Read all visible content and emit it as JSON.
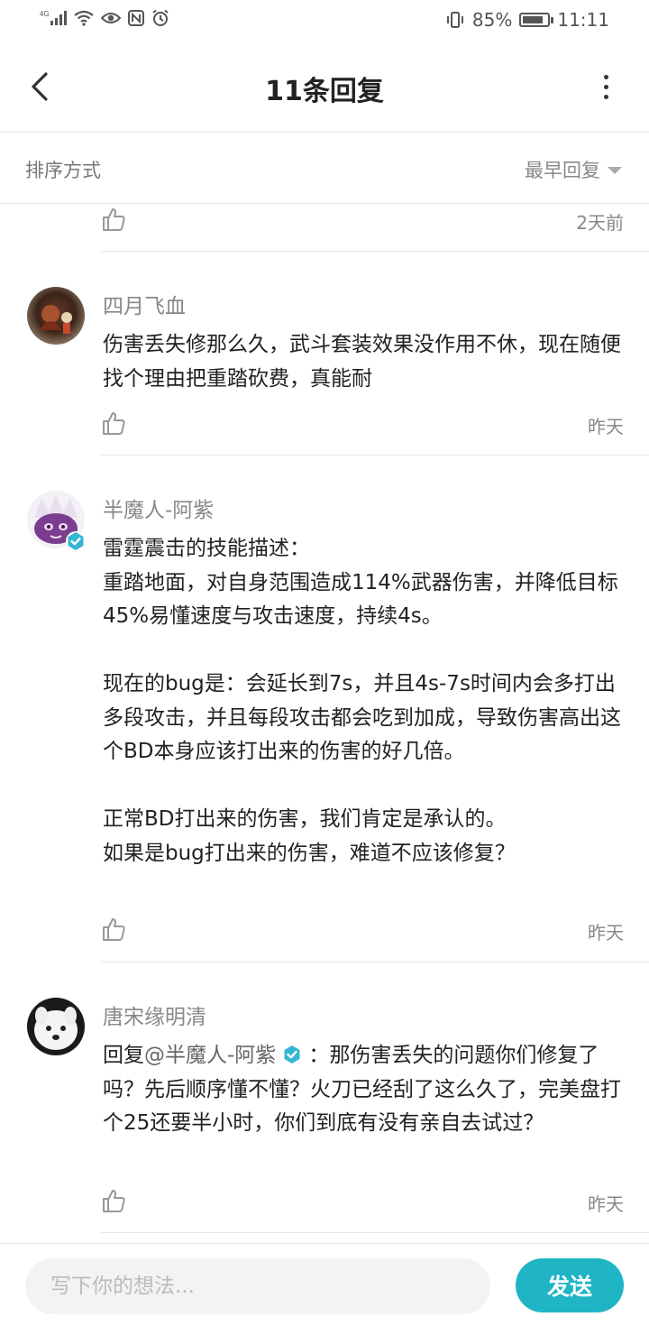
{
  "status_bar": {
    "network": "4G",
    "battery_pct": "85%",
    "battery_level": 0.85,
    "time": "11:11"
  },
  "header": {
    "title": "11条回复"
  },
  "sort": {
    "label": "排序方式",
    "value": "最早回复"
  },
  "comments": [
    {
      "time": "2天前"
    },
    {
      "username": "四月飞血",
      "content": "伤害丢失修那么久，武斗套装效果没作用不休，现在随便找个理由把重踏砍费，真能耐",
      "time": "昨天"
    },
    {
      "username": "半魔人-阿紫",
      "content": "雷霆震击的技能描述：\n重踏地面，对自身范围造成114%武器伤害，并降低目标45%易懂速度与攻击速度，持续4s。\n\n现在的bug是：会延长到7s，并且4s-7s时间内会多打出多段攻击，并且每段攻击都会吃到加成，导致伤害高出这个BD本身应该打出来的伤害的好几倍。\n\n正常BD打出来的伤害，我们肯定是承认的。\n如果是bug打出来的伤害，难道不应该修复？",
      "time": "昨天"
    },
    {
      "username": "唐宋缘明清",
      "reply_prefix": "回复",
      "reply_to": "@半魔人-阿紫",
      "content": "：那伤害丢失的问题你们修复了吗？先后顺序懂不懂？火刀已经刮了这么久了，完美盘打个25还要半小时，你们到底有没有亲自去试过？",
      "time": "昨天"
    }
  ],
  "composer": {
    "placeholder": "写下你的想法...",
    "send_label": "发送"
  },
  "colors": {
    "accent": "#1fb5c5",
    "text": "#222222",
    "muted": "#888888"
  }
}
